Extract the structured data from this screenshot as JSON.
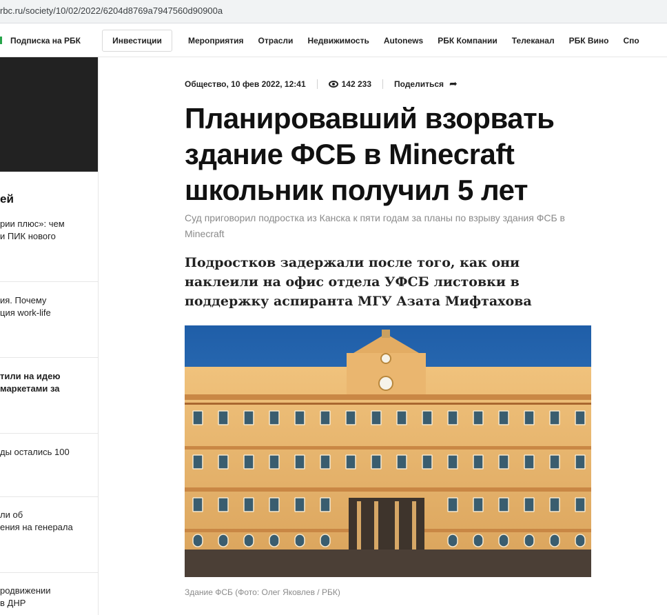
{
  "browser": {
    "url": "rbc.ru/society/10/02/2022/6204d8769a7947560d90900a"
  },
  "topnav": {
    "subscribe": "Подписка на РБК",
    "invest": "Инвестиции",
    "items": [
      "Мероприятия",
      "Отрасли",
      "Недвижимость",
      "Autonews",
      "РБК Компании",
      "Телеканал",
      "РБК Вино",
      "Спо"
    ]
  },
  "sidebar": {
    "heading": "ей",
    "items": [
      {
        "text": "рии плюс»: чем\nи ПИК нового"
      },
      {
        "text": "ия. Почему\nция work-life"
      },
      {
        "text": "тили на идею\nмаркетами за"
      },
      {
        "text": "ды остались 100"
      },
      {
        "text": "ли об\nения на генерала"
      },
      {
        "text": "родвижении\nв ДНР"
      }
    ]
  },
  "article": {
    "meta": {
      "rubric_date": "Общество, 10 фев 2022, 12:41",
      "views": "142 233",
      "share": "Поделиться"
    },
    "title": "Планировавший взорвать здание ФСБ в Minecraft школьник получил 5 лет",
    "subtitle": "Суд приговорил подростка из Канска к пяти годам за планы по взрыву здания ФСБ в Minecraft",
    "lead": "Подростков задержали после того, как они наклеили на офис отдела УФСБ листовки в поддержку аспиранта МГУ Азата Мифтахова",
    "photo_caption": "Здание ФСБ (Фото: Олег Яковлев / РБК)"
  },
  "colors": {
    "accent_green": "#27a44a",
    "sky": "#2f6fb5",
    "facade": "#e8b56a"
  }
}
